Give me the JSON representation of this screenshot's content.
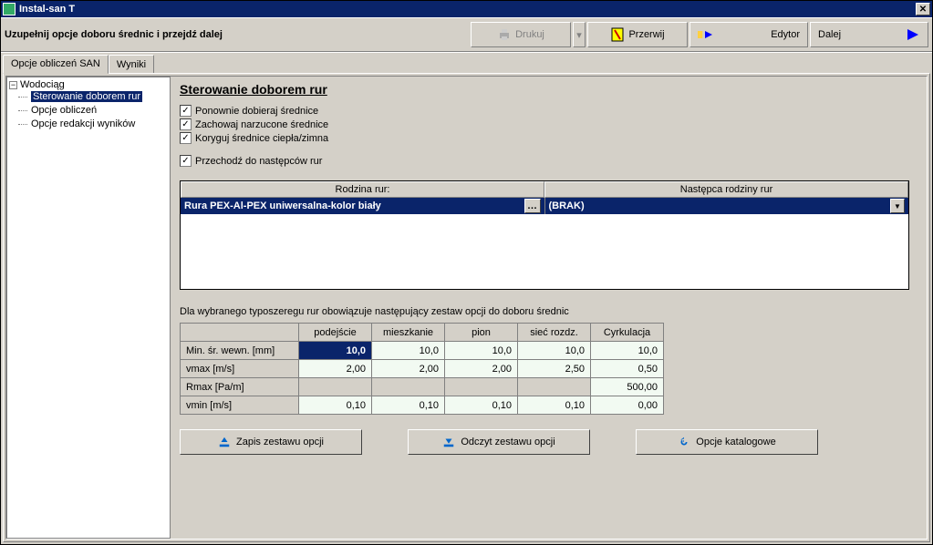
{
  "window": {
    "title": "Instal-san T"
  },
  "toolbar": {
    "instruction": "Uzupełnij opcje doboru średnic i przejdź dalej",
    "print": "Drukuj",
    "abort": "Przerwij",
    "editor": "Edytor",
    "next": "Dalej"
  },
  "tabs": {
    "calc": "Opcje obliczeń SAN",
    "results": "Wyniki"
  },
  "tree": {
    "root": "Wodociąg",
    "n1": "Sterowanie doborem rur",
    "n2": "Opcje obliczeń",
    "n3": "Opcje redakcji wyników"
  },
  "main": {
    "title": "Sterowanie doborem rur",
    "chk1": "Ponownie dobieraj średnice",
    "chk2": "Zachowaj narzucone średnice",
    "chk3": "Koryguj średnice ciepła/zimna",
    "chk4": "Przechodź do następców rur",
    "familyHead1": "Rodzina rur:",
    "familyHead2": "Następca rodziny rur",
    "familyName": "Rura PEX-Al-PEX uniwersalna-kolor biały",
    "successor": "(BRAK)",
    "note": "Dla wybranego typoszeregu rur obowiązuje następujący zestaw opcji do doboru średnic",
    "cols": {
      "c1": "podejście",
      "c2": "mieszkanie",
      "c3": "pion",
      "c4": "sieć rozdz.",
      "c5": "Cyrkulacja"
    },
    "rows": {
      "r1": "Min. śr. wewn. [mm]",
      "r2": "vmax [m/s]",
      "r3": "Rmax [Pa/m]",
      "r4": "vmin [m/s]"
    },
    "vals": {
      "r1c1": "10,0",
      "r1c2": "10,0",
      "r1c3": "10,0",
      "r1c4": "10,0",
      "r1c5": "10,0",
      "r2c1": "2,00",
      "r2c2": "2,00",
      "r2c3": "2,00",
      "r2c4": "2,50",
      "r2c5": "0,50",
      "r3c5": "500,00",
      "r4c1": "0,10",
      "r4c2": "0,10",
      "r4c3": "0,10",
      "r4c4": "0,10",
      "r4c5": "0,00"
    },
    "btnSave": "Zapis zestawu opcji",
    "btnLoad": "Odczyt zestawu opcji",
    "btnCat": "Opcje katalogowe"
  }
}
